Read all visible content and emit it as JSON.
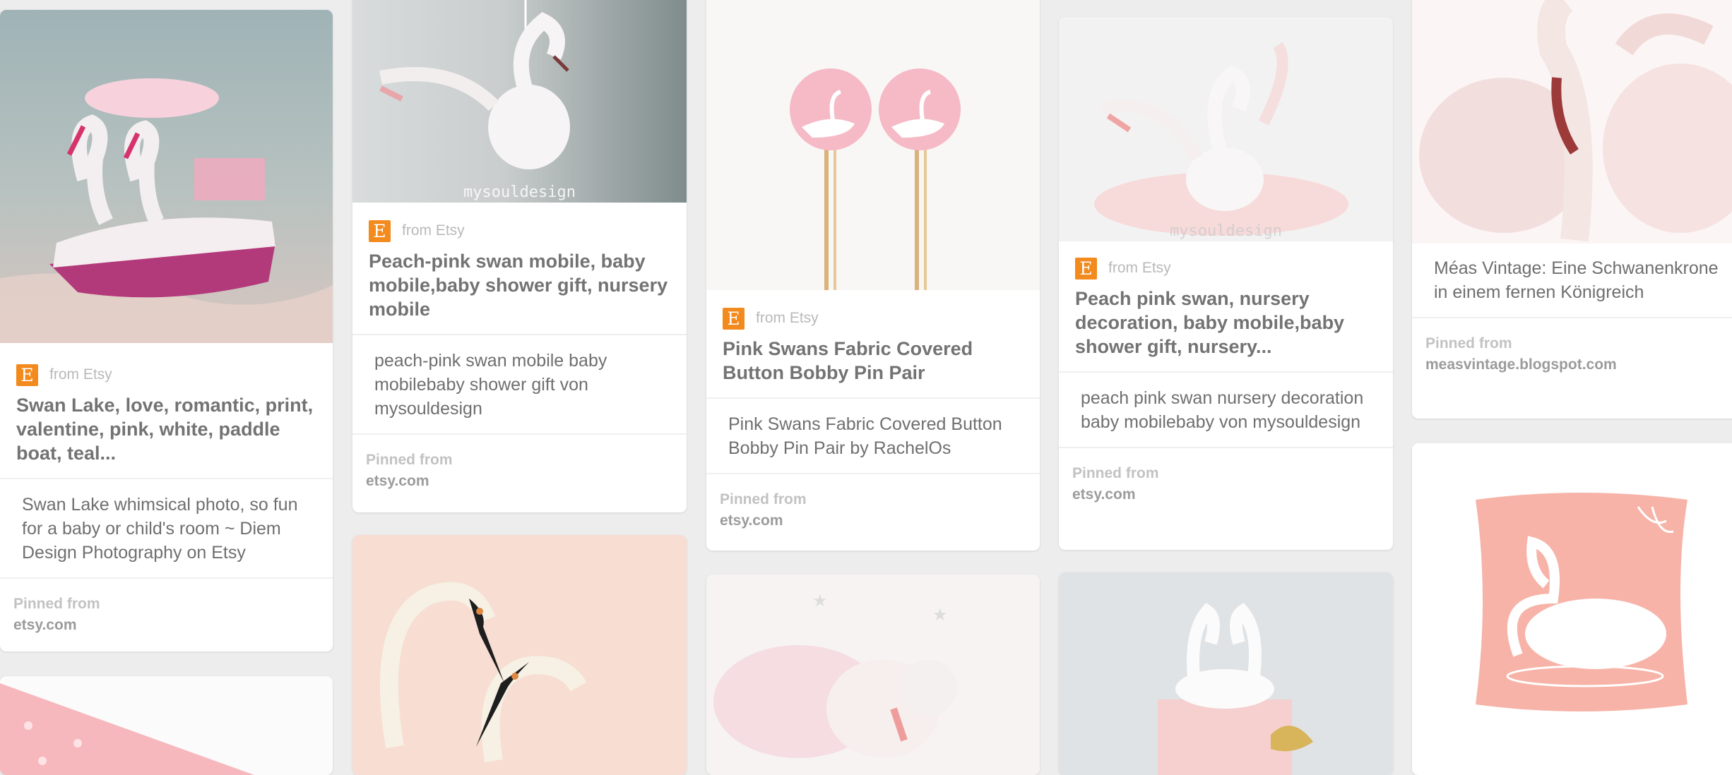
{
  "pins": [
    {
      "from": "from Etsy",
      "title": "Swan Lake, love, romantic, print, valentine, pink, white, paddle boat, teal...",
      "description": "Swan Lake whimsical photo, so fun for a baby or child's room ~ Diem Design Photography on Etsy",
      "pinned_label": "Pinned from",
      "pinned_domain": "etsy.com"
    },
    {
      "watermark": "mysouldesign",
      "from": "from Etsy",
      "title": "Peach-pink swan mobile, baby mobile,baby shower gift, nursery mobile",
      "description": "peach-pink swan mobile baby mobilebaby shower gift von mysouldesign",
      "pinned_label": "Pinned from",
      "pinned_domain": "etsy.com"
    },
    {
      "from": "from Etsy",
      "title": "Pink Swans Fabric Covered Button Bobby Pin Pair",
      "description": "Pink Swans Fabric Covered Button Bobby Pin Pair by RachelOs",
      "pinned_label": "Pinned from",
      "pinned_domain": "etsy.com"
    },
    {
      "watermark": "mysouldesign",
      "from": "from Etsy",
      "title": "Peach pink swan, nursery decoration, baby mobile,baby shower gift, nursery...",
      "description": "peach pink swan nursery decoration baby mobilebaby von mysouldesign",
      "pinned_label": "Pinned from",
      "pinned_domain": "etsy.com"
    },
    {
      "description": "Méas Vintage: Eine Schwanenkrone in einem fernen Königreich",
      "pinned_label": "Pinned from",
      "pinned_domain": "measvintage.blogspot.com"
    }
  ],
  "colors": {
    "background": "#ededed",
    "card": "#ffffff",
    "etsy_orange": "#f38a1d"
  }
}
